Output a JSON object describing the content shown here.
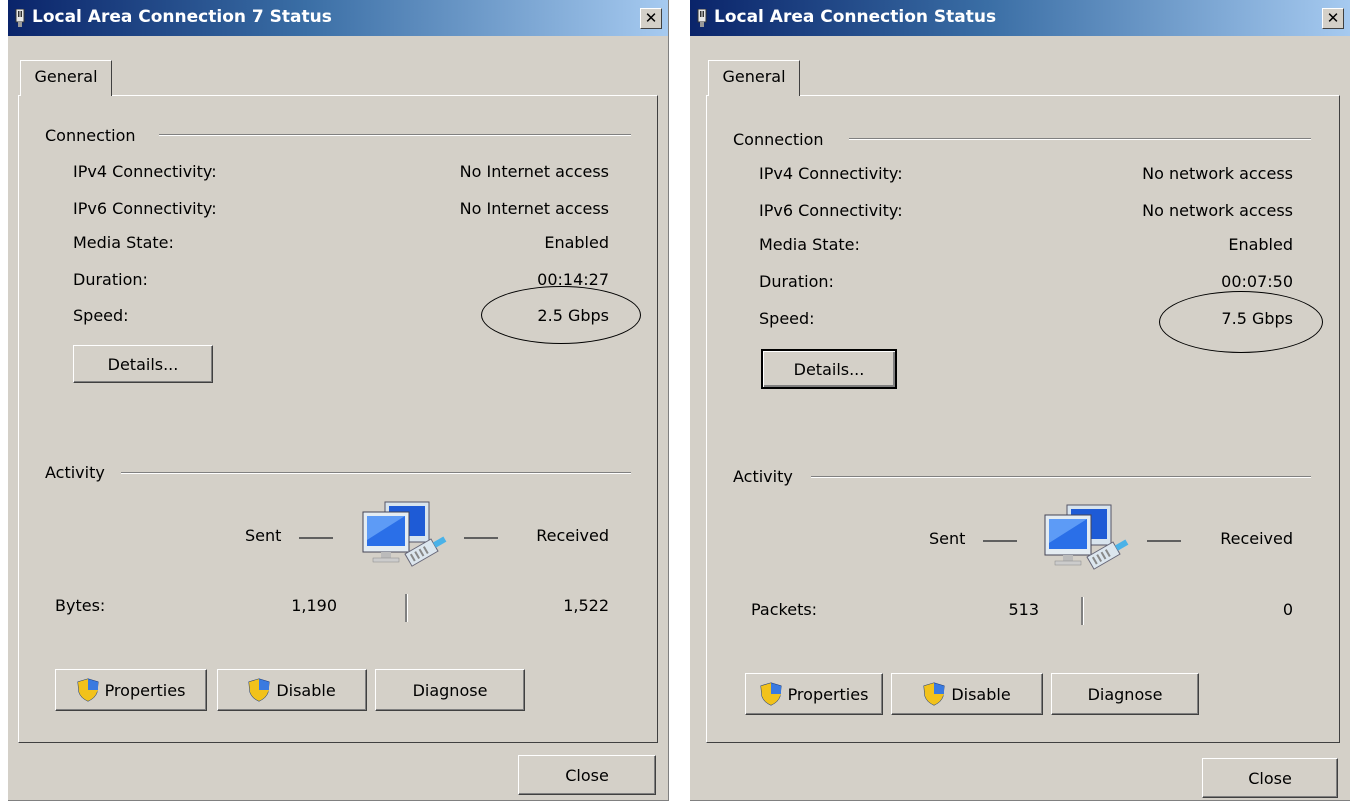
{
  "dialogs": [
    {
      "title": "Local Area Connection 7 Status",
      "close_glyph": "✕",
      "tab": "General",
      "connection_heading": "Connection",
      "rows": [
        {
          "label": "IPv4 Connectivity:",
          "value": "No Internet access"
        },
        {
          "label": "IPv6 Connectivity:",
          "value": "No Internet access"
        },
        {
          "label": "Media State:",
          "value": "Enabled"
        },
        {
          "label": "Duration:",
          "value": "00:14:27"
        },
        {
          "label": "Speed:",
          "value": "2.5 Gbps"
        }
      ],
      "details_button": "Details...",
      "activity_heading": "Activity",
      "sent_label": "Sent",
      "received_label": "Received",
      "counter_label": "Bytes:",
      "sent_value": "1,190",
      "received_value": "1,522",
      "properties_button": "Properties",
      "disable_button": "Disable",
      "diagnose_button": "Diagnose",
      "close_button": "Close"
    },
    {
      "title": "Local Area Connection Status",
      "close_glyph": "✕",
      "tab": "General",
      "connection_heading": "Connection",
      "rows": [
        {
          "label": "IPv4 Connectivity:",
          "value": "No network access"
        },
        {
          "label": "IPv6 Connectivity:",
          "value": "No network access"
        },
        {
          "label": "Media State:",
          "value": "Enabled"
        },
        {
          "label": "Duration:",
          "value": "00:07:50"
        },
        {
          "label": "Speed:",
          "value": "7.5 Gbps"
        }
      ],
      "details_button": "Details...",
      "activity_heading": "Activity",
      "sent_label": "Sent",
      "received_label": "Received",
      "counter_label": "Packets:",
      "sent_value": "513",
      "received_value": "0",
      "properties_button": "Properties",
      "disable_button": "Disable",
      "diagnose_button": "Diagnose",
      "close_button": "Close"
    }
  ],
  "icons": {
    "title": "network-adapter-icon",
    "shield": "uac-shield-icon",
    "activity": "network-computers-icon"
  },
  "colors": {
    "dialog_bg": "#d4d0c8",
    "titlebar_start": "#0a246a",
    "titlebar_end": "#a6caf0"
  }
}
